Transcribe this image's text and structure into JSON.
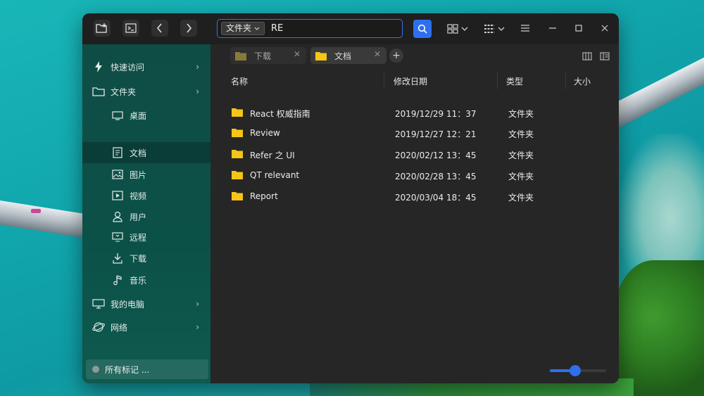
{
  "window": {
    "address": {
      "crumb": "文件夹",
      "query": "RE"
    }
  },
  "sidebar": {
    "items": [
      {
        "label": "快速访问",
        "icon": "lightning-icon",
        "expandable": true
      },
      {
        "label": "文件夹",
        "icon": "folder-outline-icon",
        "expandable": true
      },
      {
        "label": "桌面",
        "icon": "desktop-icon"
      },
      {
        "label": "文档",
        "icon": "document-icon",
        "active": true
      },
      {
        "label": "图片",
        "icon": "image-icon"
      },
      {
        "label": "视频",
        "icon": "video-icon"
      },
      {
        "label": "用户",
        "icon": "user-icon"
      },
      {
        "label": "远程",
        "icon": "remote-icon"
      },
      {
        "label": "下载",
        "icon": "download-icon"
      },
      {
        "label": "音乐",
        "icon": "music-icon"
      },
      {
        "label": "我的电脑",
        "icon": "computer-icon",
        "expandable": true
      },
      {
        "label": "网络",
        "icon": "network-icon",
        "expandable": true
      }
    ],
    "tags_label": "所有标记 ..."
  },
  "tabs": [
    {
      "label": "下载",
      "active": false
    },
    {
      "label": "文档",
      "active": true
    }
  ],
  "columns": [
    "名称",
    "修改日期",
    "类型",
    "大小"
  ],
  "files": [
    {
      "name": "React 权威指南",
      "date": "2019/12/29 11：37",
      "type": "文件夹"
    },
    {
      "name": "Review",
      "date": "2019/12/27 12：21",
      "type": "文件夹"
    },
    {
      "name": "Refer 之 UI",
      "date": "2020/02/12 13：45",
      "type": "文件夹"
    },
    {
      "name": "QT relevant",
      "date": "2020/02/28 13：45",
      "type": "文件夹"
    },
    {
      "name": "Report",
      "date": "2020/03/04 18：45",
      "type": "文件夹"
    }
  ],
  "zoom": {
    "level": 0.45
  },
  "colors": {
    "accent": "#2f6fef",
    "sidebar": "#0e4d45",
    "folder": "#f5c518"
  }
}
